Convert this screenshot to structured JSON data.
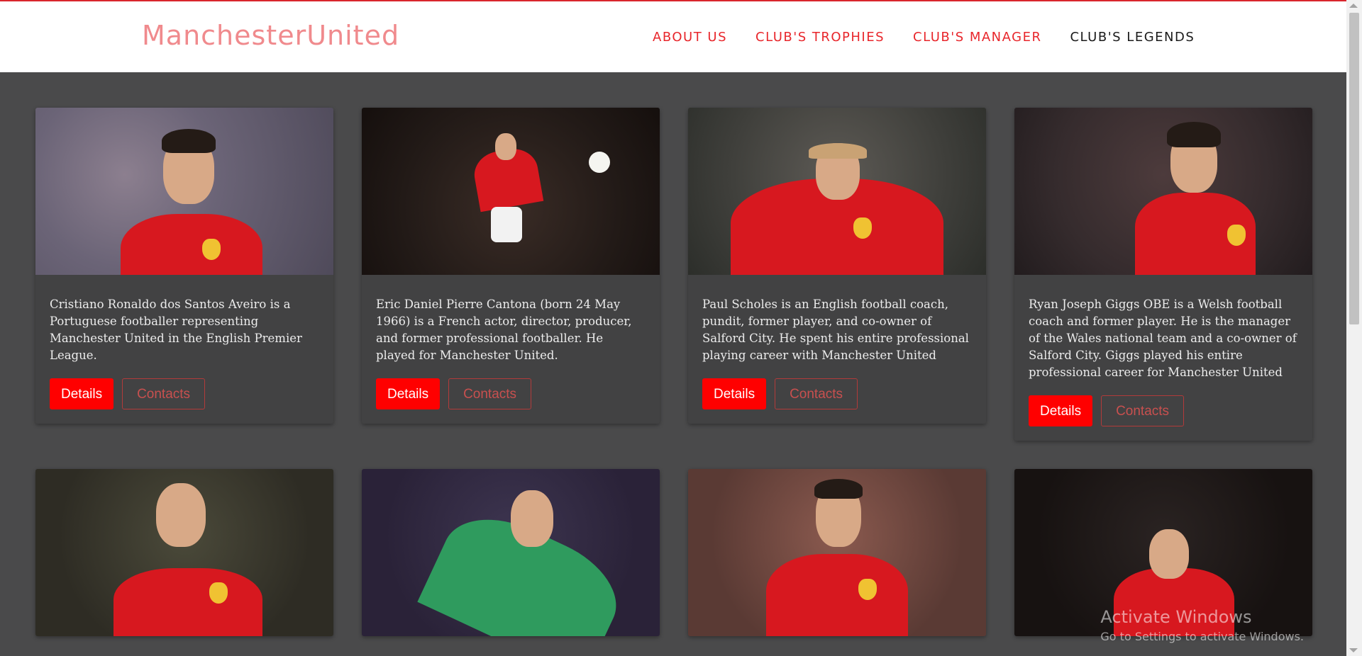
{
  "navbar": {
    "brand": "ManchesterUnited",
    "links": [
      {
        "label": "ABOUT US"
      },
      {
        "label": "CLUB'S TROPHIES"
      },
      {
        "label": "CLUB'S MANAGER"
      },
      {
        "label": "CLUB'S LEGENDS"
      }
    ],
    "active": "CLUB'S LEGENDS"
  },
  "colors": {
    "accent": "#ff0000",
    "brand": "#f08a8d",
    "page_bg": "#4a4a4b",
    "card_bg": "#424243"
  },
  "cards": [
    {
      "text": "Cristiano Ronaldo dos Santos Aveiro is a Portuguese footballer representing Manchester United in the English Premier League.",
      "details": "Details",
      "contacts": "Contacts"
    },
    {
      "text": "Eric Daniel Pierre Cantona (born 24 May 1966) is a French actor, director, producer, and former professional footballer. He played for Manchester United.",
      "details": "Details",
      "contacts": "Contacts"
    },
    {
      "text": "Paul Scholes is an English football coach, pundit, former player, and co-owner of Salford City. He spent his entire professional playing career with Manchester United",
      "details": "Details",
      "contacts": "Contacts"
    },
    {
      "text": "Ryan Joseph Giggs OBE is a Welsh football coach and former player. He is the manager of the Wales national team and a co-owner of Salford City. Giggs played his entire professional career for Manchester United",
      "details": "Details",
      "contacts": "Contacts"
    }
  ],
  "watermark": {
    "title": "Activate Windows",
    "subtitle": "Go to Settings to activate Windows."
  }
}
